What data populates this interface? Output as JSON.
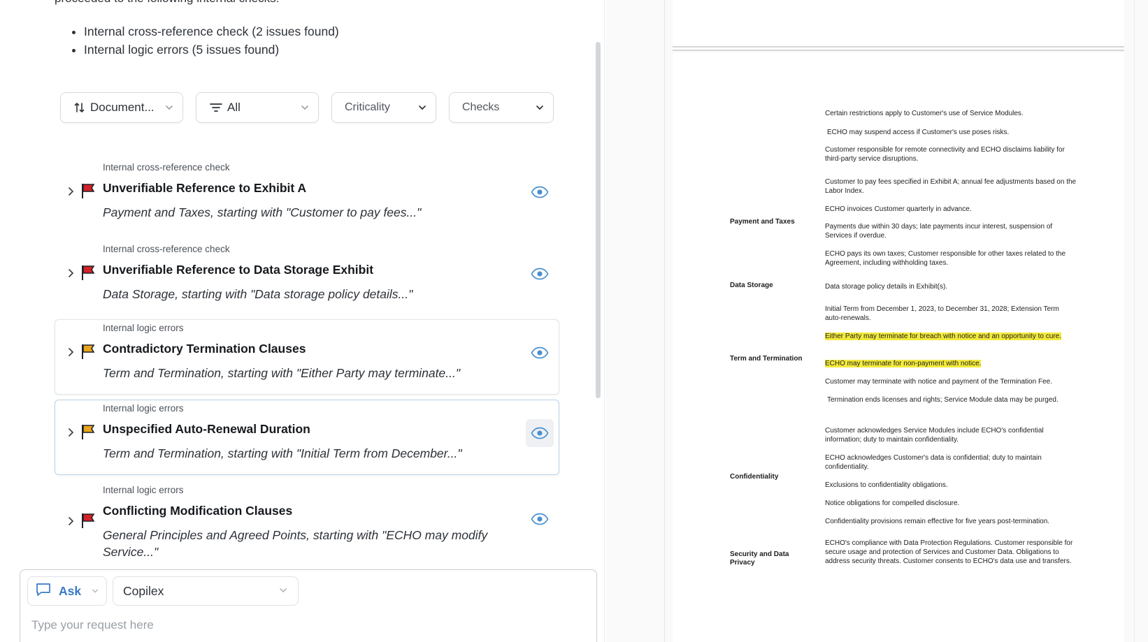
{
  "intro": {
    "text": "proceeded to the following internal checks:",
    "bullets": [
      "Internal cross-reference check (2 issues found)",
      "Internal logic errors (5 issues found)"
    ]
  },
  "filters": {
    "sort_label": "Document...",
    "type_label": "All",
    "criticality_label": "Criticality",
    "checks_label": "Checks"
  },
  "issues": [
    {
      "category": "Internal cross-reference check",
      "title": "Unverifiable Reference to Exhibit A",
      "excerpt": "Payment and Taxes, starting with \"Customer to pay fees...\"",
      "flag_color": "#d4212a"
    },
    {
      "category": "Internal cross-reference check",
      "title": "Unverifiable Reference to Data Storage Exhibit",
      "excerpt": "Data Storage, starting with \"Data storage policy details...\"",
      "flag_color": "#d4212a"
    },
    {
      "category": "Internal logic errors",
      "title": "Contradictory Termination Clauses",
      "excerpt": "Term and Termination, starting with \"Either Party may terminate...\"",
      "flag_color": "#e8a51a"
    },
    {
      "category": "Internal logic errors",
      "title": "Unspecified Auto-Renewal Duration",
      "excerpt": "Term and Termination, starting with \"Initial Term from December...\"",
      "flag_color": "#e8a51a"
    },
    {
      "category": "Internal logic errors",
      "title": "Conflicting Modification Clauses",
      "excerpt": "General Principles and Agreed Points, starting with \"ECHO may modify Service...\"",
      "flag_color": "#d4212a"
    }
  ],
  "chat": {
    "mode_label": "Ask",
    "model_label": "Copilex",
    "placeholder": "Type your request here"
  },
  "document": {
    "sections": {
      "payment": "Payment and Taxes",
      "data_storage": "Data Storage",
      "term": "Term and Termination",
      "confidentiality": "Confidentiality",
      "security": "Security and Data Privacy"
    },
    "lines": [
      "Certain restrictions apply to Customer's use of Service Modules.",
      "ECHO may suspend access if Customer's use poses risks.",
      "Customer responsible for remote connectivity and ECHO disclaims liability for third-party service disruptions.",
      "Customer to pay fees specified in Exhibit A; annual fee adjustments based on the Labor Index.",
      "ECHO invoices Customer quarterly in advance.",
      "Payments due within 30 days; late payments incur interest, suspension of Services if overdue.",
      "ECHO pays its own taxes; Customer responsible for other taxes related to the Agreement, including withholding taxes.",
      "Data storage policy details in Exhibit(s).",
      "Initial Term from December 1, 2023, to December 31, 2028; Extension Term auto-renewals.",
      "Either Party may terminate for breach with notice and an opportunity to cure.",
      "ECHO may terminate for non-payment with notice.",
      "Customer may terminate with notice and payment of the Termination Fee.",
      "Termination ends licenses and rights; Service Module data may be purged.",
      "Customer acknowledges Service Modules include ECHO's confidential information; duty to maintain confidentiality.",
      "ECHO acknowledges Customer's data is confidential; duty to maintain confidentiality.",
      "Exclusions to confidentiality obligations.",
      "Notice obligations for compelled disclosure.",
      "Confidentiality provisions remain effective for five years post-termination.",
      "ECHO's compliance with Data Protection Regulations. Customer responsible for secure usage and protection of Services and Customer Data. Obligations to address security threats. Customer consents to ECHO's data use and transfers."
    ]
  },
  "colors": {
    "accent_blue": "#3a78c7",
    "flag_red": "#d4212a",
    "flag_amber": "#e8a51a",
    "highlight_yellow": "#f3ea3c"
  }
}
